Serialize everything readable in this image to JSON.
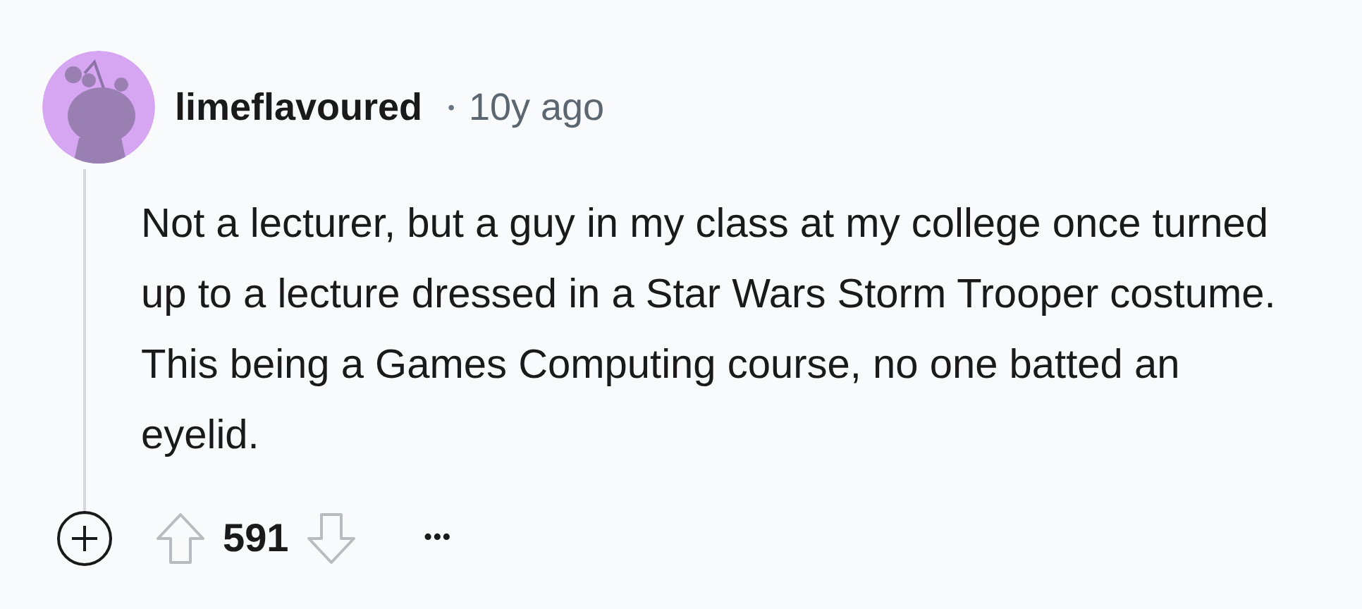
{
  "comment": {
    "author": "limeflavoured",
    "separator": "•",
    "time": "10y ago",
    "body": "Not a lecturer, but a guy in my class at my college once turned up to a lecture dressed in a Star Wars Storm Trooper costume. This being a Games Computing course, no one batted an eyelid.",
    "score": "591",
    "more": "•••"
  }
}
